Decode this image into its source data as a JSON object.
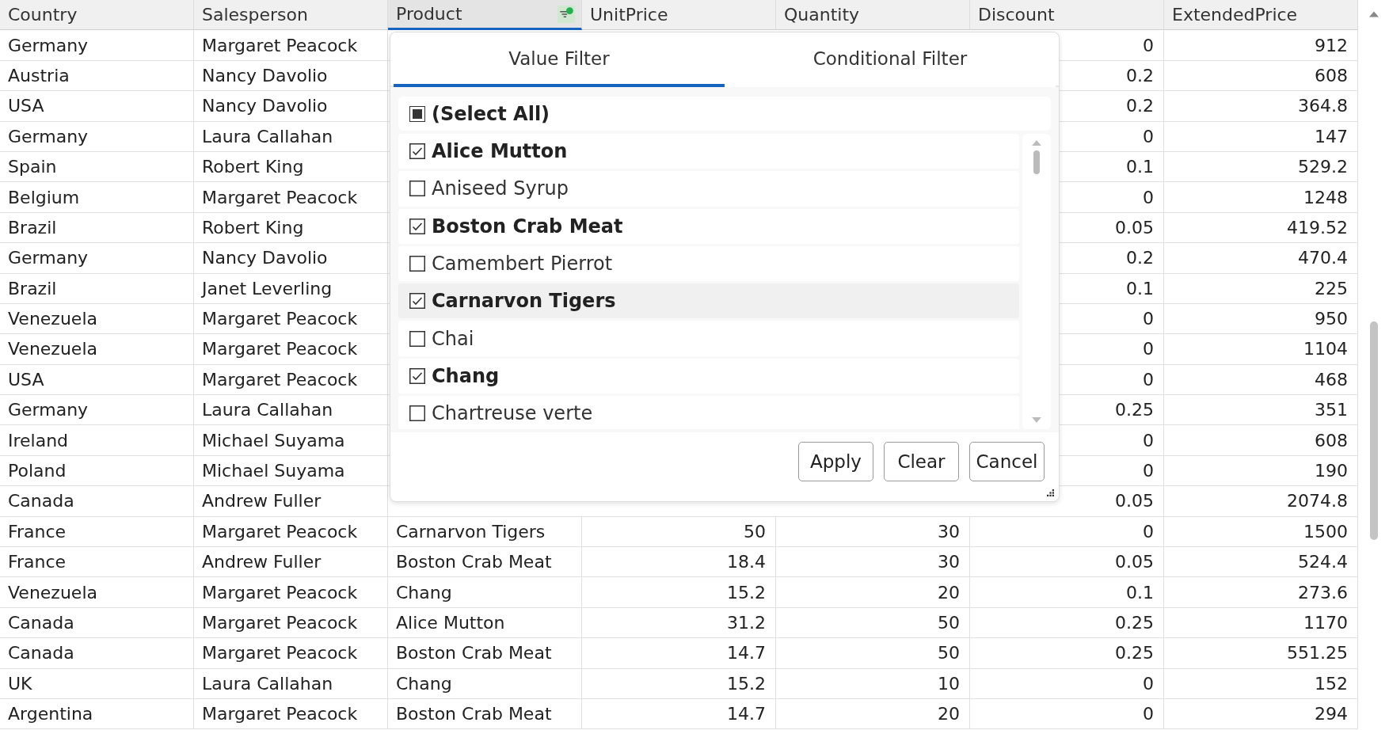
{
  "grid": {
    "columns": [
      {
        "label": "Country",
        "filtered": false
      },
      {
        "label": "Salesperson",
        "filtered": false
      },
      {
        "label": "Product",
        "filtered": true
      },
      {
        "label": "UnitPrice",
        "filtered": false
      },
      {
        "label": "Quantity",
        "filtered": false
      },
      {
        "label": "Discount",
        "filtered": false
      },
      {
        "label": "ExtendedPrice",
        "filtered": false
      }
    ],
    "rows": [
      {
        "cells": [
          "Germany",
          "Margaret Peacock",
          null,
          null,
          null,
          "0",
          "912"
        ]
      },
      {
        "cells": [
          "Austria",
          "Nancy Davolio",
          null,
          null,
          null,
          "0.2",
          "608"
        ]
      },
      {
        "cells": [
          "USA",
          "Nancy Davolio",
          null,
          null,
          null,
          "0.2",
          "364.8"
        ]
      },
      {
        "cells": [
          "Germany",
          "Laura Callahan",
          null,
          null,
          null,
          "0",
          "147"
        ]
      },
      {
        "cells": [
          "Spain",
          "Robert King",
          null,
          null,
          null,
          "0.1",
          "529.2"
        ]
      },
      {
        "cells": [
          "Belgium",
          "Margaret Peacock",
          null,
          null,
          null,
          "0",
          "1248"
        ]
      },
      {
        "cells": [
          "Brazil",
          "Robert King",
          null,
          null,
          null,
          "0.05",
          "419.52"
        ]
      },
      {
        "cells": [
          "Germany",
          "Nancy Davolio",
          null,
          null,
          null,
          "0.2",
          "470.4"
        ]
      },
      {
        "cells": [
          "Brazil",
          "Janet Leverling",
          null,
          null,
          null,
          "0.1",
          "225"
        ]
      },
      {
        "cells": [
          "Venezuela",
          "Margaret Peacock",
          null,
          null,
          null,
          "0",
          "950"
        ]
      },
      {
        "cells": [
          "Venezuela",
          "Margaret Peacock",
          null,
          null,
          null,
          "0",
          "1104"
        ]
      },
      {
        "cells": [
          "USA",
          "Margaret Peacock",
          null,
          null,
          null,
          "0",
          "468"
        ]
      },
      {
        "cells": [
          "Germany",
          "Laura Callahan",
          null,
          null,
          null,
          "0.25",
          "351"
        ]
      },
      {
        "cells": [
          "Ireland",
          "Michael Suyama",
          null,
          null,
          null,
          "0",
          "608"
        ]
      },
      {
        "cells": [
          "Poland",
          "Michael Suyama",
          null,
          null,
          null,
          "0",
          "190"
        ]
      },
      {
        "cells": [
          "Canada",
          "Andrew Fuller",
          null,
          null,
          null,
          "0.05",
          "2074.8"
        ]
      },
      {
        "cells": [
          "France",
          "Margaret Peacock",
          "Carnarvon Tigers",
          "50",
          "30",
          "0",
          "1500"
        ]
      },
      {
        "cells": [
          "France",
          "Andrew Fuller",
          "Boston Crab Meat",
          "18.4",
          "30",
          "0.05",
          "524.4"
        ]
      },
      {
        "cells": [
          "Venezuela",
          "Margaret Peacock",
          "Chang",
          "15.2",
          "20",
          "0.1",
          "273.6"
        ]
      },
      {
        "cells": [
          "Canada",
          "Margaret Peacock",
          "Alice Mutton",
          "31.2",
          "50",
          "0.25",
          "1170"
        ]
      },
      {
        "cells": [
          "Canada",
          "Margaret Peacock",
          "Boston Crab Meat",
          "14.7",
          "50",
          "0.25",
          "551.25"
        ]
      },
      {
        "cells": [
          "UK",
          "Laura Callahan",
          "Chang",
          "15.2",
          "10",
          "0",
          "152"
        ]
      },
      {
        "cells": [
          "Argentina",
          "Margaret Peacock",
          "Boston Crab Meat",
          "14.7",
          "20",
          "0",
          "294"
        ]
      }
    ]
  },
  "filter_popup": {
    "tabs": [
      {
        "label": "Value Filter",
        "selected": true
      },
      {
        "label": "Conditional Filter",
        "selected": false
      }
    ],
    "select_all": {
      "label": "(Select All)",
      "indeterminate": true
    },
    "items": [
      {
        "label": "Alice Mutton",
        "checked": true,
        "highlighted": false
      },
      {
        "label": "Aniseed Syrup",
        "checked": false,
        "highlighted": false
      },
      {
        "label": "Boston Crab Meat",
        "checked": true,
        "highlighted": false
      },
      {
        "label": "Camembert Pierrot",
        "checked": false,
        "highlighted": false
      },
      {
        "label": "Carnarvon Tigers",
        "checked": true,
        "highlighted": true
      },
      {
        "label": "Chai",
        "checked": false,
        "highlighted": false
      },
      {
        "label": "Chang",
        "checked": true,
        "highlighted": false
      },
      {
        "label": "Chartreuse verte",
        "checked": false,
        "highlighted": false
      }
    ],
    "buttons": [
      "Apply",
      "Clear",
      "Cancel"
    ]
  }
}
